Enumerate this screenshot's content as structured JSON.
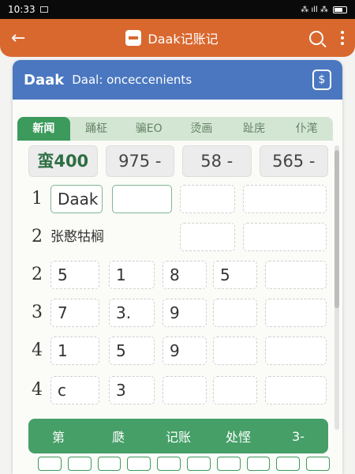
{
  "status": {
    "time": "10:33",
    "indicators": "⁂ ıll ⁂"
  },
  "toolbar": {
    "back_label": "←",
    "title": "Daak记账记"
  },
  "header": {
    "brand": "Daak",
    "subtitle": "Daal: onceccenients"
  },
  "tabs": [
    {
      "label": "新闻",
      "active": true
    },
    {
      "label": "踊柾",
      "active": false
    },
    {
      "label": "骗EO",
      "active": false
    },
    {
      "label": "烫画",
      "active": false
    },
    {
      "label": "趾庑",
      "active": false
    },
    {
      "label": "仆滗",
      "active": false
    }
  ],
  "summary": [
    "蛮400",
    "975 -",
    "58 -",
    "565 -"
  ],
  "rows": [
    {
      "num": "1",
      "text": "",
      "cells": [
        "Daak",
        "",
        "",
        ""
      ]
    },
    {
      "num": "2",
      "text": "张憨牯榈",
      "cells": [
        "",
        ""
      ]
    },
    {
      "num": "2",
      "text": "",
      "cells": [
        "5",
        "1",
        "8",
        "5",
        ""
      ]
    },
    {
      "num": "3",
      "text": "",
      "cells": [
        "7",
        "3.",
        "9",
        "",
        ""
      ]
    },
    {
      "num": "4",
      "text": "",
      "cells": [
        "1",
        "5",
        "9",
        "",
        ""
      ]
    },
    {
      "num": "4",
      "text": "",
      "cells": [
        "c",
        "3",
        "",
        "",
        ""
      ]
    }
  ],
  "bottom_bar": [
    "第",
    "瓞",
    "记账",
    "处悭",
    "3-"
  ],
  "colors": {
    "accent": "#d9682f",
    "header": "#4a77c0",
    "green": "#3a9a5e"
  }
}
